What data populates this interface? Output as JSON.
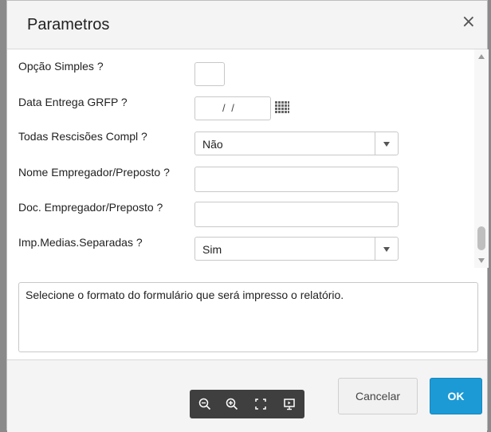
{
  "dialog": {
    "title": "Parametros",
    "close_glyph": "×"
  },
  "params": [
    {
      "label": "Opção Simples ?",
      "control": "checkbox"
    },
    {
      "label": "Data Entrega GRFP ?",
      "control": "date",
      "value": "/ /"
    },
    {
      "label": "Todas Rescisões Compl ?",
      "control": "select",
      "value": "Não"
    },
    {
      "label": "Nome Empregador/Preposto ?",
      "control": "text",
      "value": ""
    },
    {
      "label": "Doc. Empregador/Preposto ?",
      "control": "text",
      "value": ""
    },
    {
      "label": "Imp.Medias.Separadas ?",
      "control": "select",
      "value": "Sim"
    }
  ],
  "help": {
    "text": "Selecione o formato do formulário que será impresso o relatório."
  },
  "footer": {
    "cancel_label": "Cancelar",
    "ok_label": "OK"
  },
  "icons": {
    "close": "close-icon",
    "calendar": "calendar-icon",
    "dropdown": "chevron-down-icon",
    "zoom_out": "zoom-out-icon",
    "zoom_in": "zoom-in-icon",
    "fit": "fit-screen-icon",
    "present": "presentation-icon"
  },
  "colors": {
    "ok_button": "#1b9ad6",
    "toolbar": "#3f3f3f",
    "header": "#f4f4f4"
  }
}
